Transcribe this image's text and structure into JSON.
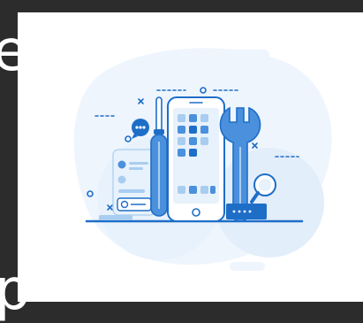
{
  "colors": {
    "page_background": "#2c2c2c",
    "card_background": "#ffffff",
    "accent_blue": "#1e6ec8",
    "light_blue": "#a8cdf0",
    "pale_blue": "#e8f2fc",
    "mid_blue": "#4a90dd"
  },
  "edge_text": {
    "top_glyph": "e",
    "bottom_glyph": "p"
  },
  "illustration": {
    "subject": "phone-with-tools"
  }
}
